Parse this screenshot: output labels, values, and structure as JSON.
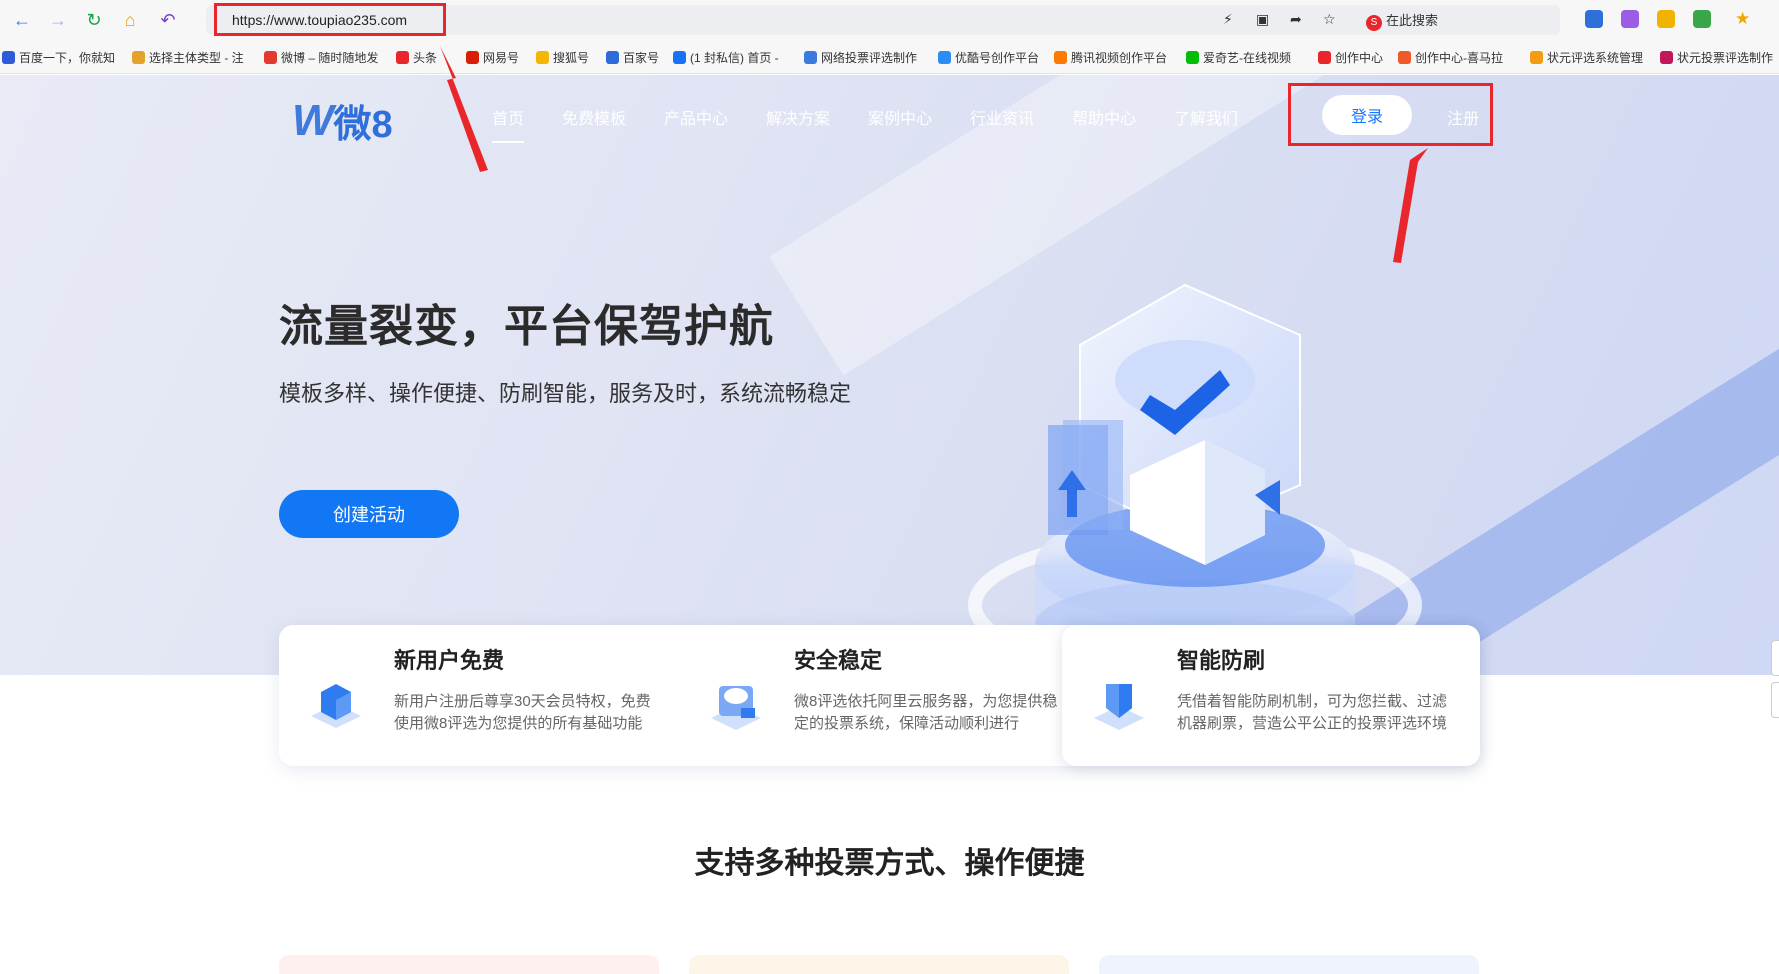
{
  "browser": {
    "url": "https://www.toupiao235.com",
    "search_label": "在此搜索",
    "bookmarks": [
      {
        "label": "百度一下，你就知",
        "color": "#2f5bd8"
      },
      {
        "label": "选择主体类型 - 注",
        "color": "#e2a22c"
      },
      {
        "label": "微博 – 随时随地发",
        "color": "#e23a2e"
      },
      {
        "label": "头条",
        "color": "#e8262b"
      },
      {
        "label": "网易号",
        "color": "#d81e06"
      },
      {
        "label": "搜狐号",
        "color": "#f2b705"
      },
      {
        "label": "百家号",
        "color": "#2d6bd8"
      },
      {
        "label": "(1 封私信) 首页 -",
        "color": "#1772f6"
      },
      {
        "label": "网络投票评选制作",
        "color": "#3b7be0"
      },
      {
        "label": "优酷号创作平台",
        "color": "#2c8cf5"
      },
      {
        "label": "腾讯视频创作平台",
        "color": "#ff7a00"
      },
      {
        "label": "爱奇艺-在线视频",
        "color": "#00be06"
      },
      {
        "label": "创作中心",
        "color": "#e8262b"
      },
      {
        "label": "创作中心-喜马拉",
        "color": "#f05a28"
      },
      {
        "label": "状元评选系统管理",
        "color": "#f39c12"
      },
      {
        "label": "状元投票评选制作",
        "color": "#c2185b"
      }
    ]
  },
  "site": {
    "logo_text": "微8",
    "nav": [
      "首页",
      "免费模板",
      "产品中心",
      "解决方案",
      "案例中心",
      "行业资讯",
      "帮助中心",
      "了解我们"
    ],
    "login_label": "登录",
    "register_label": "注册"
  },
  "hero": {
    "title": "流量裂变，平台保驾护航",
    "subtitle": "模板多样、操作便捷、防刷智能，服务及时，系统流畅稳定",
    "cta_label": "创建活动"
  },
  "features": [
    {
      "title": "新用户免费",
      "desc": "新用户注册后尊享30天会员特权，免费使用微8评选为您提供的所有基础功能",
      "icon": "cube-icon"
    },
    {
      "title": "安全稳定",
      "desc": "微8评选依托阿里云服务器，为您提供稳定的投票系统，保障活动顺利进行",
      "icon": "cloud-server-icon"
    },
    {
      "title": "智能防刷",
      "desc": "凭借着智能防刷机制，可为您拦截、过滤机器刷票，营造公平公正的投票评选环境",
      "icon": "shield-icon"
    }
  ],
  "section_title": "支持多种投票方式、操作便捷",
  "colors": {
    "brand": "#1277f5",
    "highlight_box": "#e8262b"
  }
}
